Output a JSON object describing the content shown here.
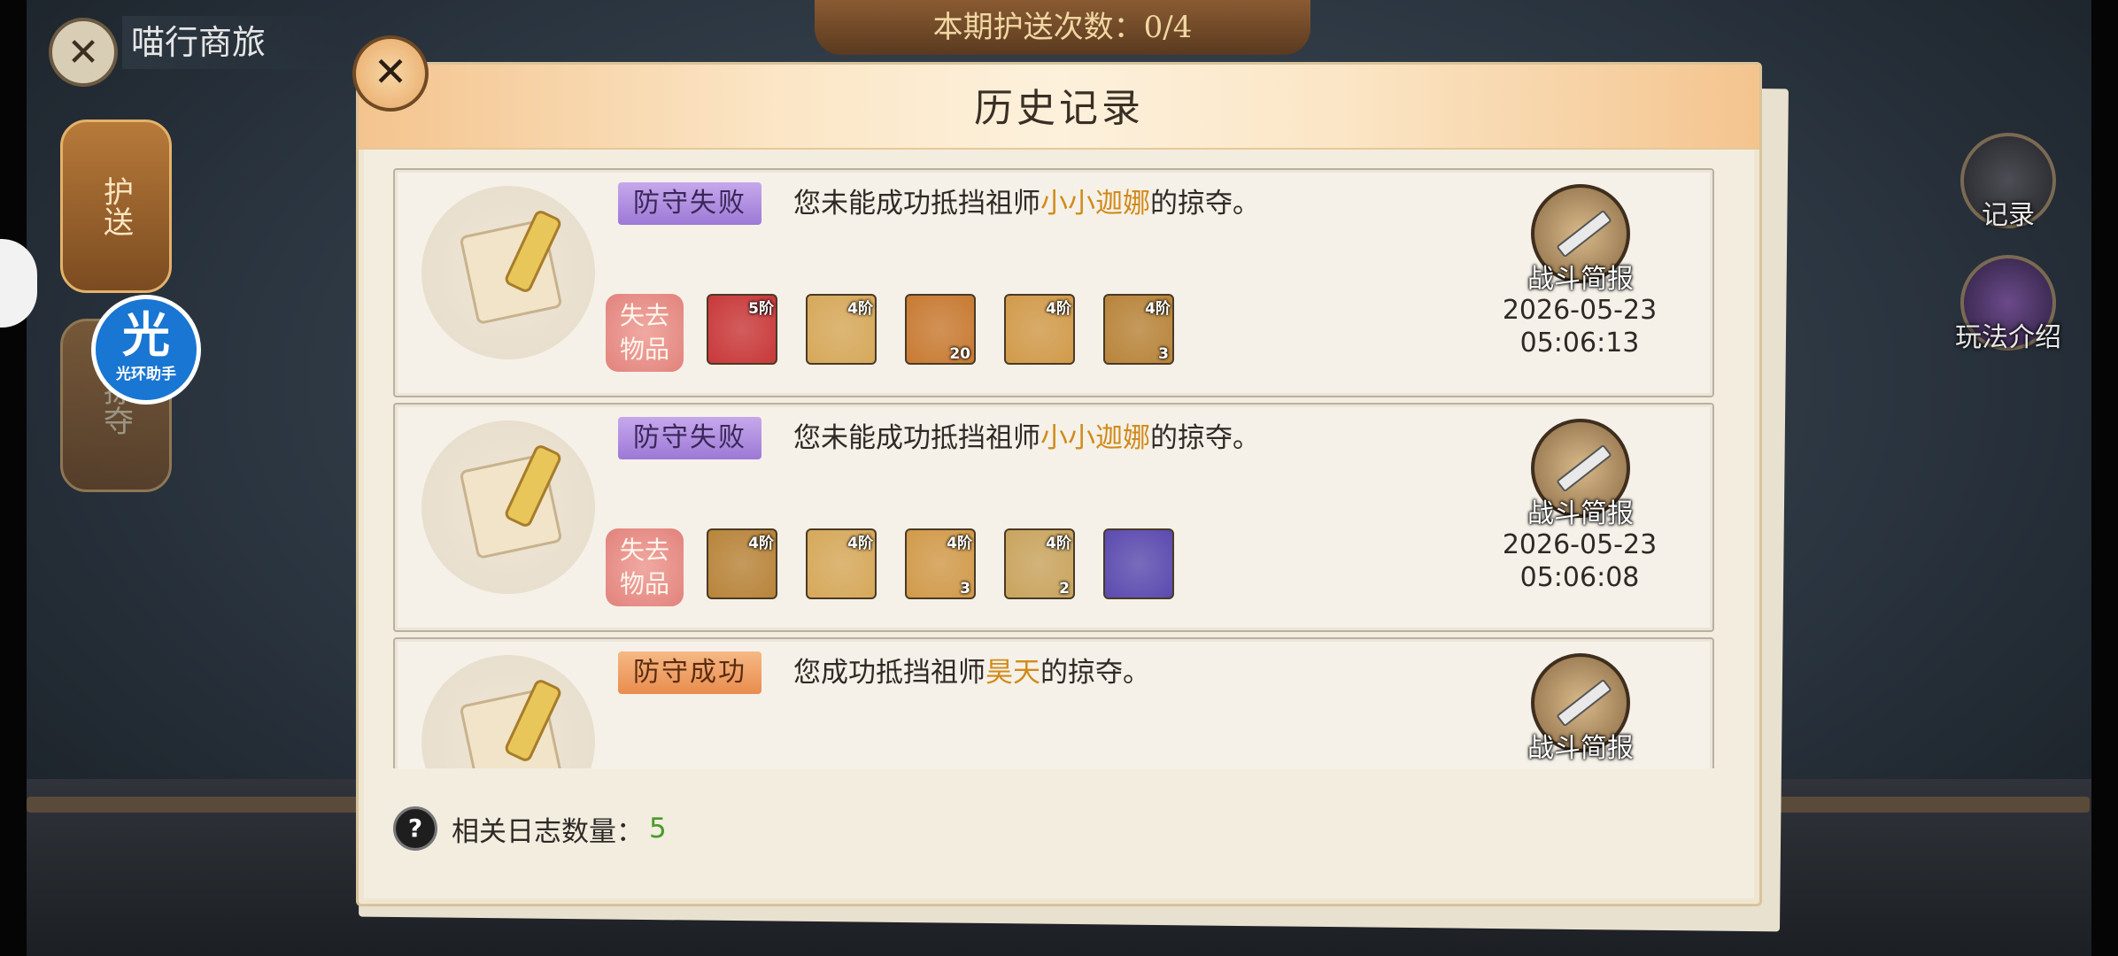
{
  "scene": {
    "title": "喵行商旅",
    "escort_count_text": "本期护送次数：0/4",
    "tabs": [
      "护送",
      "掠夺"
    ],
    "right_buttons": [
      {
        "label": "记录",
        "icon": "record-icon"
      },
      {
        "label": "玩法介绍",
        "icon": "guide-icon"
      }
    ],
    "assistant": {
      "big": "光",
      "small": "光环助手"
    }
  },
  "dialog": {
    "title": "历史记录",
    "footer_label": "相关日志数量：",
    "footer_count": "5"
  },
  "colors": {
    "highlight_name": "#d18a1a",
    "fail_tag": "#9c79d6",
    "success_tag": "#e98c4e",
    "count_green": "#4a9a2c"
  },
  "records": [
    {
      "status": "防守失败",
      "status_type": "fail",
      "message_pre": "您未能成功抵挡祖师",
      "name": "小小迦娜",
      "message_post": "的掠夺。",
      "loss_label": "失去物品",
      "items": [
        {
          "tier": "5阶",
          "qty": "",
          "icon": "scroll-item-icon",
          "color": "#c9383a"
        },
        {
          "tier": "4阶",
          "qty": "",
          "icon": "gem-pile-icon",
          "color": "#d6a85a"
        },
        {
          "tier": "",
          "qty": "20",
          "icon": "emblem-icon",
          "color": "#c87a32"
        },
        {
          "tier": "4阶",
          "qty": "",
          "icon": "crate-icon",
          "color": "#d19a4a"
        },
        {
          "tier": "4阶",
          "qty": "3",
          "icon": "chest-icon",
          "color": "#b8843a"
        }
      ],
      "battle_label": "战斗简报",
      "date": "2026-05-23",
      "time": "05:06:13"
    },
    {
      "status": "防守失败",
      "status_type": "fail",
      "message_pre": "您未能成功抵挡祖师",
      "name": "小小迦娜",
      "message_post": "的掠夺。",
      "loss_label": "失去物品",
      "items": [
        {
          "tier": "4阶",
          "qty": "",
          "icon": "chest-icon",
          "color": "#b8843a"
        },
        {
          "tier": "4阶",
          "qty": "",
          "icon": "gem-pile-icon",
          "color": "#d6a85a"
        },
        {
          "tier": "4阶",
          "qty": "3",
          "icon": "crate-icon",
          "color": "#d19a4a"
        },
        {
          "tier": "4阶",
          "qty": "2",
          "icon": "gem-tray-icon",
          "color": "#c9a45e"
        },
        {
          "tier": "",
          "qty": "",
          "icon": "spirit-orb-icon",
          "color": "#5a4ab0"
        }
      ],
      "battle_label": "战斗简报",
      "date": "2026-05-23",
      "time": "05:06:08"
    },
    {
      "status": "防守成功",
      "status_type": "success",
      "message_pre": "您成功抵挡祖师",
      "name": "昊天",
      "message_post": "的掠夺。",
      "loss_label": "",
      "items": [],
      "battle_label": "战斗简报",
      "date": "",
      "time": ""
    }
  ]
}
